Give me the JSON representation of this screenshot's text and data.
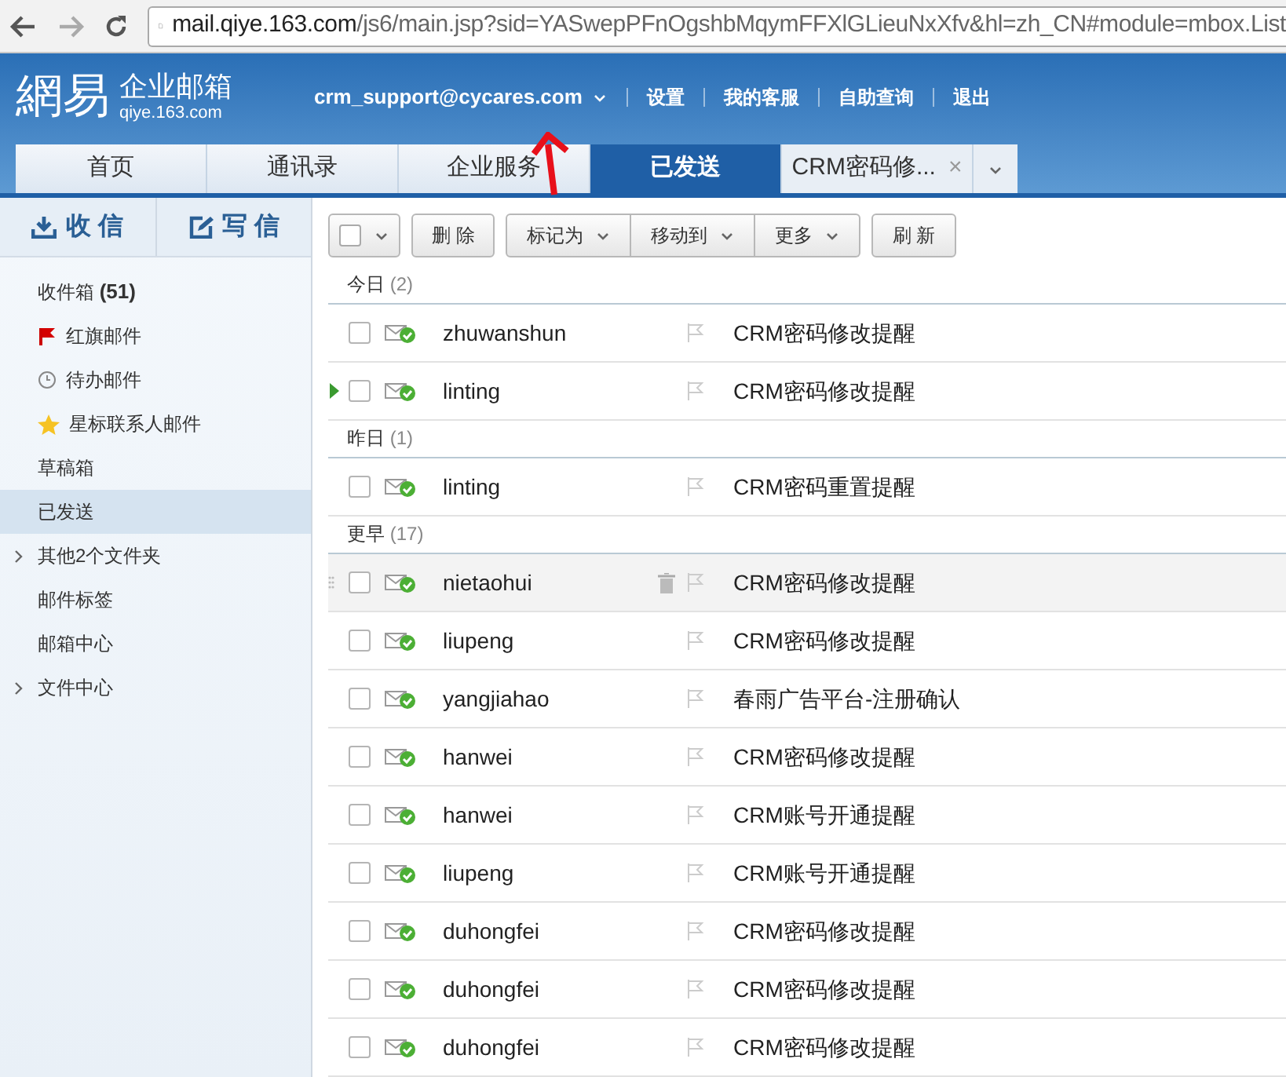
{
  "browser": {
    "url_host": "mail.qiye.163.com",
    "url_path": "/js6/main.jsp?sid=YASwepPFnOgshbMqymFFXlGLieuNxXfv&hl=zh_CN#module=mbox.List"
  },
  "header": {
    "logo": "網易",
    "product": "企业邮箱",
    "domain": "qiye.163.com",
    "account": "crm_support@cycares.com",
    "links": [
      "设置",
      "我的客服",
      "自助查询",
      "退出"
    ]
  },
  "tabs": [
    {
      "label": "首页",
      "selected": false,
      "closable": false
    },
    {
      "label": "通讯录",
      "selected": false,
      "closable": false
    },
    {
      "label": "企业服务",
      "selected": false,
      "closable": false
    },
    {
      "label": "已发送",
      "selected": true,
      "closable": false
    },
    {
      "label": "CRM密码修...",
      "selected": false,
      "closable": true,
      "close": "×"
    }
  ],
  "sidebar": {
    "actions": [
      {
        "kind": "receive",
        "label": "收 信"
      },
      {
        "kind": "compose",
        "label": "写 信"
      }
    ],
    "items": [
      {
        "label": "收件箱",
        "count": "(51)",
        "kind": "plain",
        "expandable": false,
        "selected": false
      },
      {
        "label": "红旗邮件",
        "kind": "flagged",
        "expandable": false,
        "selected": false
      },
      {
        "label": "待办邮件",
        "kind": "todo",
        "expandable": false,
        "selected": false
      },
      {
        "label": "星标联系人邮件",
        "kind": "starred",
        "expandable": false,
        "selected": false
      },
      {
        "label": "草稿箱",
        "kind": "plain",
        "expandable": false,
        "selected": false
      },
      {
        "label": "已发送",
        "kind": "plain",
        "expandable": false,
        "selected": true
      },
      {
        "label": "其他2个文件夹",
        "kind": "plain",
        "expandable": true,
        "selected": false
      },
      {
        "label": "邮件标签",
        "kind": "plain",
        "expandable": false,
        "selected": false
      },
      {
        "label": "邮箱中心",
        "kind": "plain",
        "expandable": false,
        "selected": false
      },
      {
        "label": "文件中心",
        "kind": "plain",
        "expandable": true,
        "selected": false
      }
    ]
  },
  "toolbar": [
    {
      "kind": "select"
    },
    {
      "kind": "button",
      "label": "删 除"
    },
    {
      "kind": "menu",
      "label": "标记为"
    },
    {
      "kind": "menu",
      "label": "移动到"
    },
    {
      "kind": "menu",
      "label": "更多"
    },
    {
      "kind": "button",
      "label": "刷 新"
    }
  ],
  "groups": [
    {
      "title": "今日",
      "count": "(2)",
      "rows": [
        {
          "sender": "zhuwanshun",
          "subject": "CRM密码修改提醒",
          "checked": false,
          "hovered": false,
          "current": false
        },
        {
          "sender": "linting",
          "subject": "CRM密码修改提醒",
          "checked": false,
          "hovered": false,
          "current": true
        }
      ]
    },
    {
      "title": "昨日",
      "count": "(1)",
      "rows": [
        {
          "sender": "linting",
          "subject": "CRM密码重置提醒",
          "checked": false,
          "hovered": false,
          "current": false
        }
      ]
    },
    {
      "title": "更早",
      "count": "(17)",
      "rows": [
        {
          "sender": "nietaohui",
          "subject": "CRM密码修改提醒",
          "checked": false,
          "hovered": true,
          "current": false
        },
        {
          "sender": "liupeng",
          "subject": "CRM密码修改提醒",
          "checked": false,
          "hovered": false,
          "current": false
        },
        {
          "sender": "yangjiahao",
          "subject": "春雨广告平台-注册确认",
          "checked": false,
          "hovered": false,
          "current": false
        },
        {
          "sender": "hanwei",
          "subject": "CRM密码修改提醒",
          "checked": false,
          "hovered": false,
          "current": false
        },
        {
          "sender": "hanwei",
          "subject": "CRM账号开通提醒",
          "checked": false,
          "hovered": false,
          "current": false
        },
        {
          "sender": "liupeng",
          "subject": "CRM账号开通提醒",
          "checked": false,
          "hovered": false,
          "current": false
        },
        {
          "sender": "duhongfei",
          "subject": "CRM密码修改提醒",
          "checked": false,
          "hovered": false,
          "current": false
        },
        {
          "sender": "duhongfei",
          "subject": "CRM密码修改提醒",
          "checked": false,
          "hovered": false,
          "current": false
        },
        {
          "sender": "duhongfei",
          "subject": "CRM密码修改提醒",
          "checked": false,
          "hovered": false,
          "current": false
        }
      ]
    }
  ]
}
